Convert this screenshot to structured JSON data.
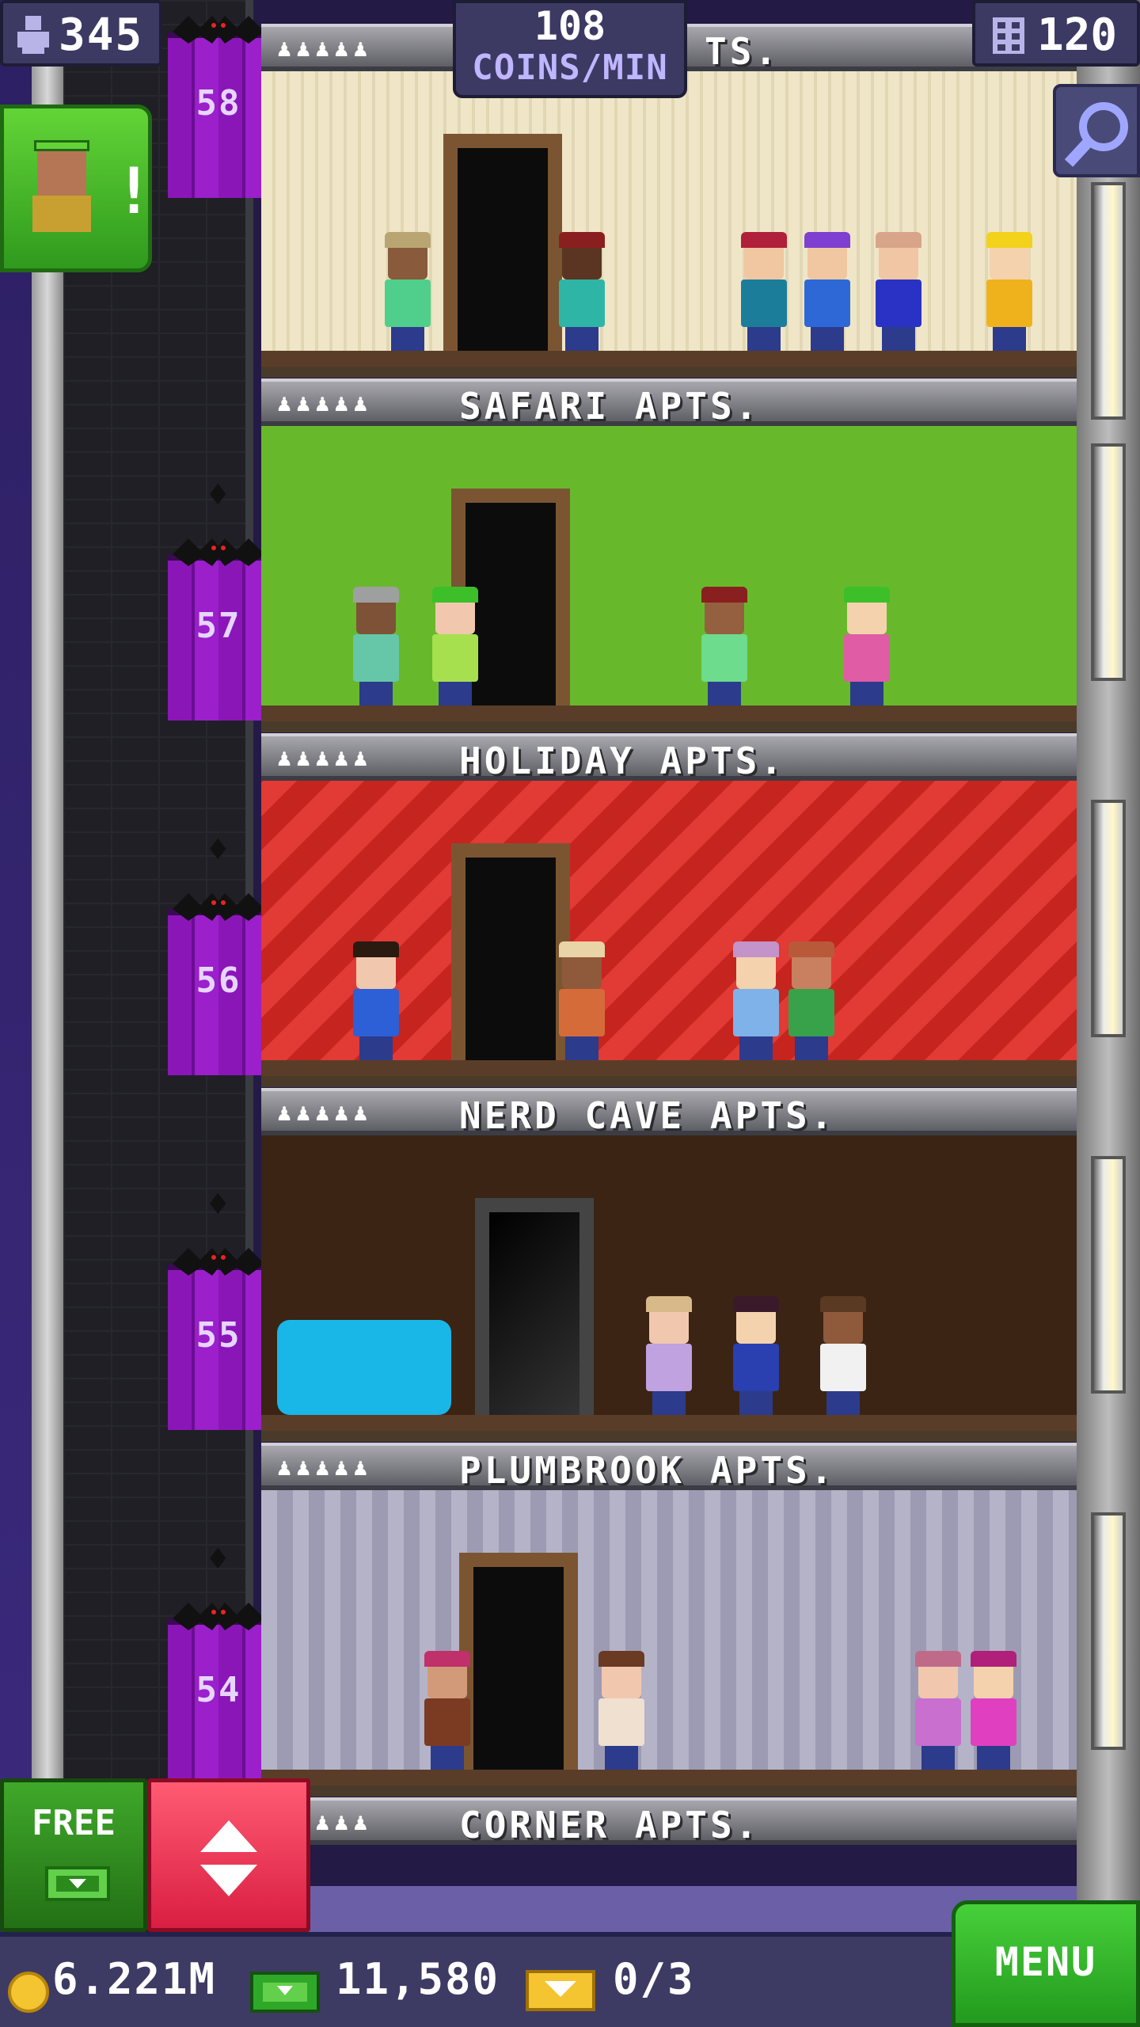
{
  "hud": {
    "population": "345",
    "coins_per_min_value": "108",
    "coins_per_min_label": "COINS/MIN",
    "floors": "120"
  },
  "floors": [
    {
      "name": "SAFARI APTS.",
      "stars": "♟♟♟♟♟",
      "elevator_number": "57"
    },
    {
      "name": "HOLIDAY APTS.",
      "stars": "♟♟♟♟♟",
      "elevator_number": "56"
    },
    {
      "name": "NERD CAVE APTS.",
      "stars": "♟♟♟♟♟",
      "elevator_number": "55"
    },
    {
      "name": "PLUMBROOK APTS.",
      "stars": "♟♟♟♟♟",
      "elevator_number": "54"
    },
    {
      "name": "CORNER APTS.",
      "stars": "♟♟♟♟♟"
    }
  ],
  "top_floor": {
    "name_partial": "TS.",
    "stars": "♟♟♟♟♟",
    "elevator_number": "58"
  },
  "vip": {
    "alert": "!"
  },
  "controls": {
    "free_label": "FREE",
    "menu_label": "MENU"
  },
  "currency": {
    "coins": "6.221M",
    "bux": "11,580",
    "tickets": "0/3"
  },
  "colors": {
    "coin": "#f5c431",
    "bux": "#2fa82a",
    "elevator_door": "#8b16b8",
    "menu": "#47d03a",
    "elevator_button": "#ff5b73"
  }
}
